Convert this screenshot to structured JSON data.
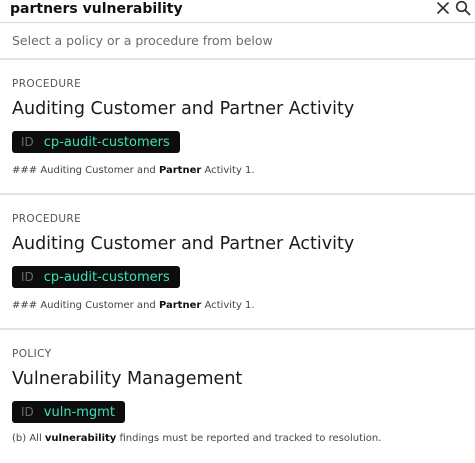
{
  "search": {
    "query": "partners vulnerability",
    "hint": "Select a policy or a procedure from below"
  },
  "icons": {
    "clear": "close-icon",
    "search": "search-icon"
  },
  "colors": {
    "badge_background": "#0d0d0d",
    "badge_value": "#3fe0b7",
    "divider": "#e3e3e3"
  },
  "results": [
    {
      "type": "PROCEDURE",
      "title": "Auditing Customer and Partner Activity",
      "id_label": "ID",
      "id_value": "cp-audit-customers",
      "snippet_before": "### Auditing Customer and ",
      "snippet_match": "Partner",
      "snippet_after": " Activity 1."
    },
    {
      "type": "PROCEDURE",
      "title": "Auditing Customer and Partner Activity",
      "id_label": "ID",
      "id_value": "cp-audit-customers",
      "snippet_before": "### Auditing Customer and ",
      "snippet_match": "Partner",
      "snippet_after": " Activity 1."
    },
    {
      "type": "POLICY",
      "title": "Vulnerability Management",
      "id_label": "ID",
      "id_value": "vuln-mgmt",
      "snippet_before": "(b) All ",
      "snippet_match": "vulnerability",
      "snippet_after": " findings must be reported and tracked to resolution."
    }
  ]
}
